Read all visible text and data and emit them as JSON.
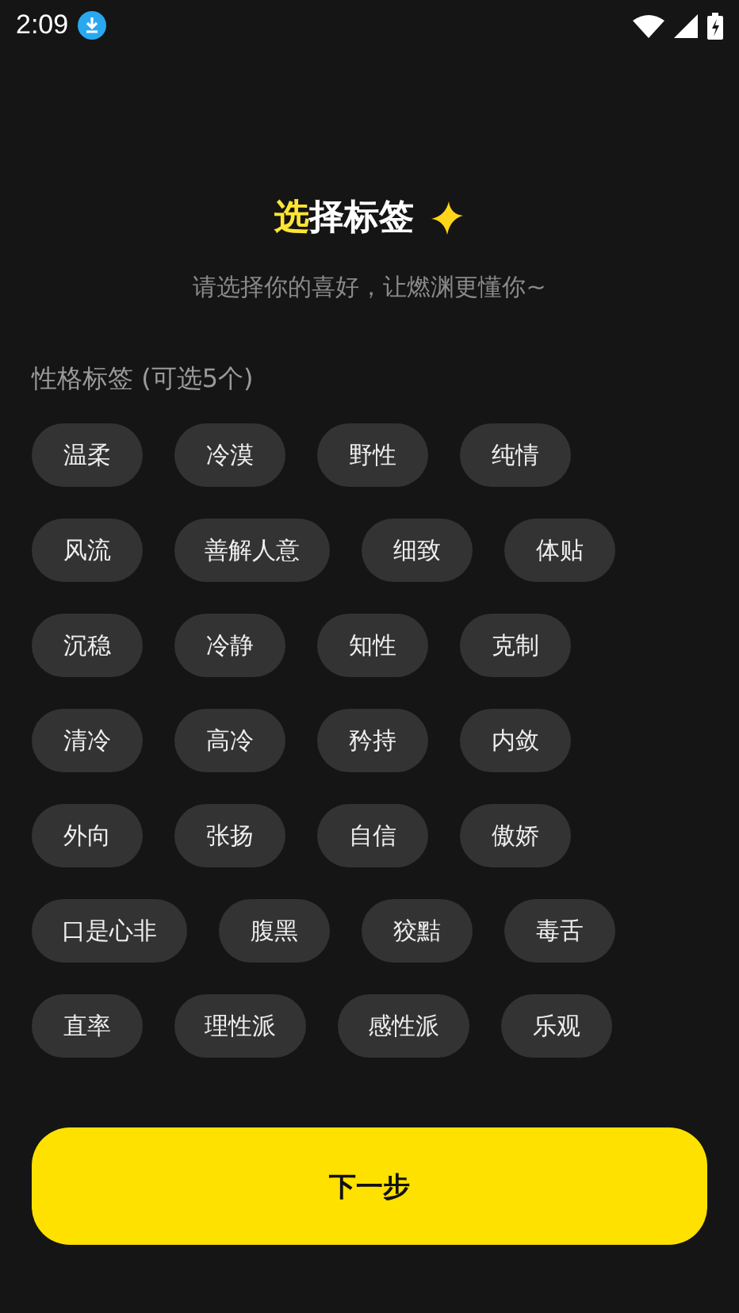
{
  "status_bar": {
    "time": "2:09"
  },
  "header": {
    "title_accent": "选",
    "title_rest": "择标签",
    "subtitle": "请选择你的喜好，让燃渊更懂你~"
  },
  "section": {
    "label": "性格标签 (可选5个)"
  },
  "tags": [
    {
      "label": "温柔",
      "selected": false
    },
    {
      "label": "冷漠",
      "selected": false
    },
    {
      "label": "野性",
      "selected": false
    },
    {
      "label": "纯情",
      "selected": false
    },
    {
      "label": "风流",
      "selected": false
    },
    {
      "label": "善解人意",
      "selected": false
    },
    {
      "label": "细致",
      "selected": false
    },
    {
      "label": "体贴",
      "selected": false
    },
    {
      "label": "沉稳",
      "selected": false
    },
    {
      "label": "冷静",
      "selected": false
    },
    {
      "label": "知性",
      "selected": false
    },
    {
      "label": "克制",
      "selected": false
    },
    {
      "label": "清冷",
      "selected": false
    },
    {
      "label": "高冷",
      "selected": false
    },
    {
      "label": "矜持",
      "selected": false
    },
    {
      "label": "内敛",
      "selected": false
    },
    {
      "label": "外向",
      "selected": false
    },
    {
      "label": "张扬",
      "selected": false
    },
    {
      "label": "自信",
      "selected": false
    },
    {
      "label": "傲娇",
      "selected": false
    },
    {
      "label": "口是心非",
      "selected": false
    },
    {
      "label": "腹黑",
      "selected": false
    },
    {
      "label": "狡黠",
      "selected": false
    },
    {
      "label": "毒舌",
      "selected": false
    },
    {
      "label": "直率",
      "selected": false
    },
    {
      "label": "理性派",
      "selected": false
    },
    {
      "label": "感性派",
      "selected": false
    },
    {
      "label": "乐观",
      "selected": false
    }
  ],
  "next_button": {
    "label": "下一步"
  }
}
